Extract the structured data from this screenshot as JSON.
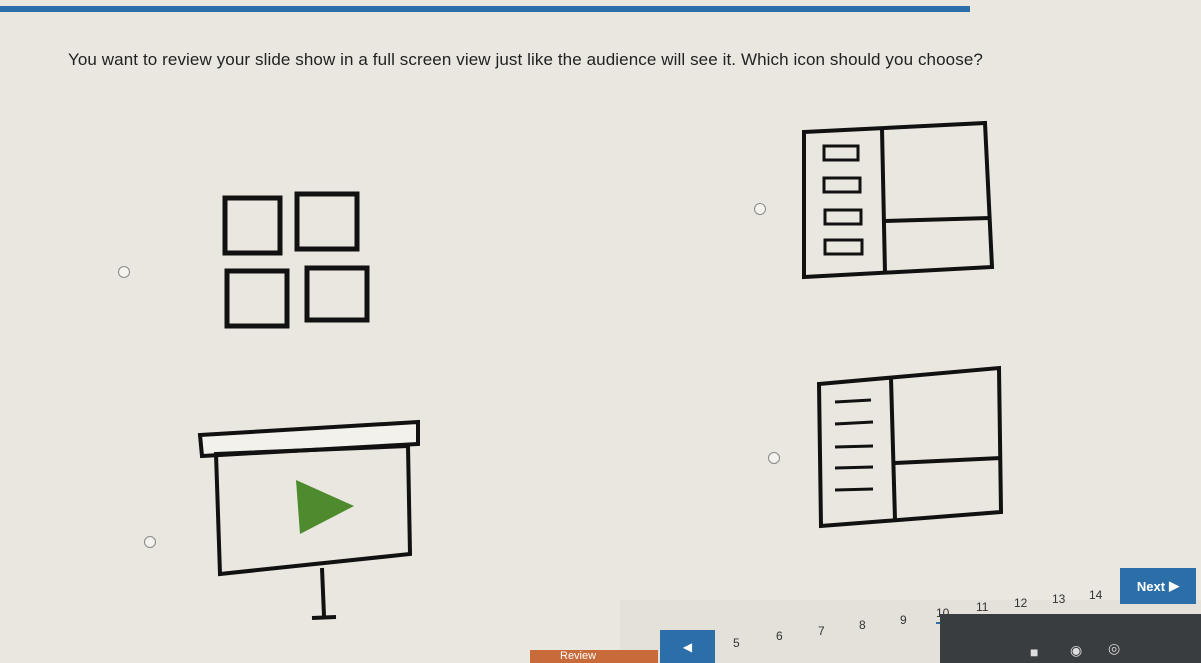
{
  "question": {
    "text": "You want to review your slide show in a full screen view just like the audience will see it. Which icon should you choose?"
  },
  "options": [
    {
      "icon": "slide-sorter-icon"
    },
    {
      "icon": "normal-view-thumbnails-icon"
    },
    {
      "icon": "slide-show-icon"
    },
    {
      "icon": "outline-view-icon"
    }
  ],
  "navigation": {
    "next_label": "Next",
    "review_label": "Review",
    "prev_icon": "chevron-left-icon",
    "pages": [
      "5",
      "6",
      "7",
      "8",
      "9",
      "10",
      "11",
      "12",
      "13",
      "14"
    ],
    "current_page": "10"
  },
  "colors": {
    "accent": "#2c6fa8",
    "play_green": "#4e8a2e",
    "review_orange": "#c96a3a"
  }
}
